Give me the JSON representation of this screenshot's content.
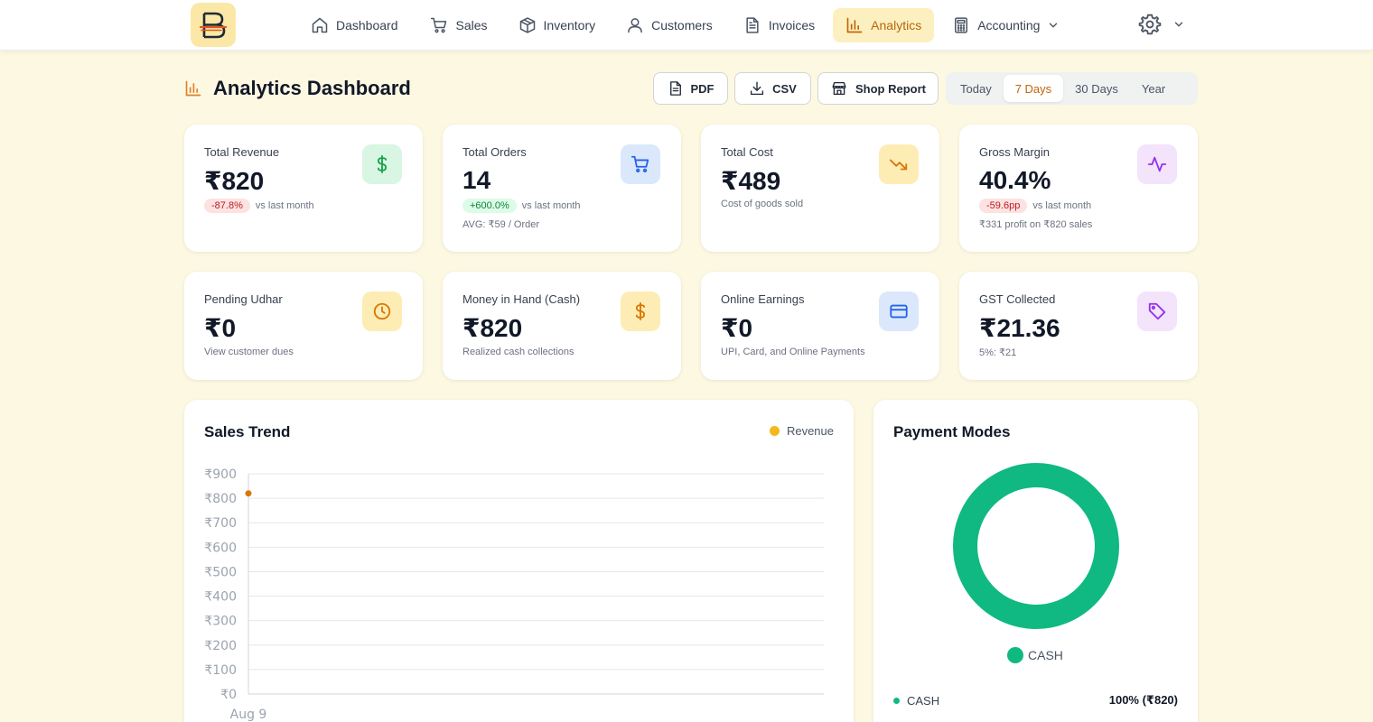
{
  "nav": {
    "items": [
      {
        "label": "Dashboard",
        "icon": "home-icon"
      },
      {
        "label": "Sales",
        "icon": "cart-icon"
      },
      {
        "label": "Inventory",
        "icon": "box-icon"
      },
      {
        "label": "Customers",
        "icon": "user-icon"
      },
      {
        "label": "Invoices",
        "icon": "document-icon"
      },
      {
        "label": "Analytics",
        "icon": "bar-chart-icon",
        "active": true
      },
      {
        "label": "Accounting",
        "icon": "calculator-icon"
      }
    ]
  },
  "header": {
    "title": "Analytics Dashboard",
    "pdf_label": "PDF",
    "csv_label": "CSV",
    "shop_report_label": "Shop Report",
    "ranges": [
      "Today",
      "7 Days",
      "30 Days",
      "Year"
    ],
    "active_range": "7 Days"
  },
  "cards": [
    {
      "label": "Total Revenue",
      "value": "₹820",
      "change": "-87.8%",
      "change_note": "vs last month",
      "sub": ""
    },
    {
      "label": "Total Orders",
      "value": "14",
      "change": "+600.0%",
      "change_note": "vs last month",
      "sub": "AVG: ₹59 / Order"
    },
    {
      "label": "Total Cost",
      "value": "₹489",
      "sub": "Cost of goods sold"
    },
    {
      "label": "Gross Margin",
      "value": "40.4%",
      "change": "-59.6pp",
      "change_note": "vs last month",
      "sub": "₹331 profit on ₹820 sales"
    },
    {
      "label": "Pending Udhar",
      "value": "₹0",
      "sub": "View customer dues"
    },
    {
      "label": "Money in Hand (Cash)",
      "value": "₹820",
      "sub": "Realized cash collections"
    },
    {
      "label": "Online Earnings",
      "value": "₹0",
      "sub": "UPI, Card, and Online Payments"
    },
    {
      "label": "GST Collected",
      "value": "₹21.36",
      "sub": "5%: ₹21"
    }
  ],
  "sales_trend": {
    "title": "Sales Trend",
    "legend": "Revenue"
  },
  "payment_modes": {
    "title": "Payment Modes",
    "legend": "CASH",
    "row_label": "CASH",
    "row_value": "100% (₹820)"
  },
  "colors": {
    "accent": "#c2640b",
    "revenue": "#f4b81c",
    "cash": "#10b981",
    "background": "#fdf8e2"
  },
  "chart_data": [
    {
      "type": "line",
      "title": "Sales Trend",
      "x": [
        "Aug 9"
      ],
      "series": [
        {
          "name": "Revenue",
          "values": [
            820
          ]
        }
      ],
      "ylim": [
        0,
        900
      ],
      "yticks": [
        "₹0",
        "₹100",
        "₹200",
        "₹300",
        "₹400",
        "₹500",
        "₹600",
        "₹700",
        "₹800",
        "₹900"
      ],
      "grid": true,
      "legend": "top-right"
    },
    {
      "type": "pie",
      "title": "Payment Modes",
      "categories": [
        "CASH"
      ],
      "values": [
        820
      ],
      "percent": [
        100
      ],
      "legend": "bottom"
    }
  ]
}
